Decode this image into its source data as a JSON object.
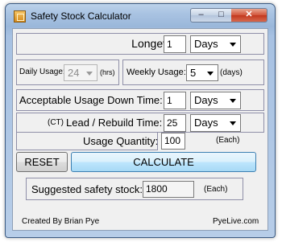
{
  "window": {
    "title": "Safety Stock Calculator",
    "minimize": "–",
    "maximize": "□",
    "close": "✕",
    "icon": "calculator-app-icon"
  },
  "longevity": {
    "label": "Longevity:",
    "value": "1",
    "unit": "Days"
  },
  "daily_usage": {
    "label": "Daily Usage:",
    "value": "24",
    "unit": "(hrs)"
  },
  "weekly_usage": {
    "label": "Weekly Usage:",
    "value": "5",
    "unit": "(days)"
  },
  "downtime": {
    "label": "Acceptable Usage Down Time:",
    "value": "1",
    "unit": "Days"
  },
  "lead_time": {
    "prefix": "(CT)",
    "label": "Lead / Rebuild Time:",
    "value": "25",
    "unit": "Days"
  },
  "quantity": {
    "label": "Usage Quantity:",
    "value": "100",
    "unit": "(Each)"
  },
  "buttons": {
    "reset": "RESET",
    "calculate": "CALCULATE"
  },
  "result": {
    "label": "Suggested safety stock:",
    "value": "1800",
    "unit": "(Each)"
  },
  "footer": {
    "left": "Created By Brian Pye",
    "right": "PyeLive.com"
  }
}
